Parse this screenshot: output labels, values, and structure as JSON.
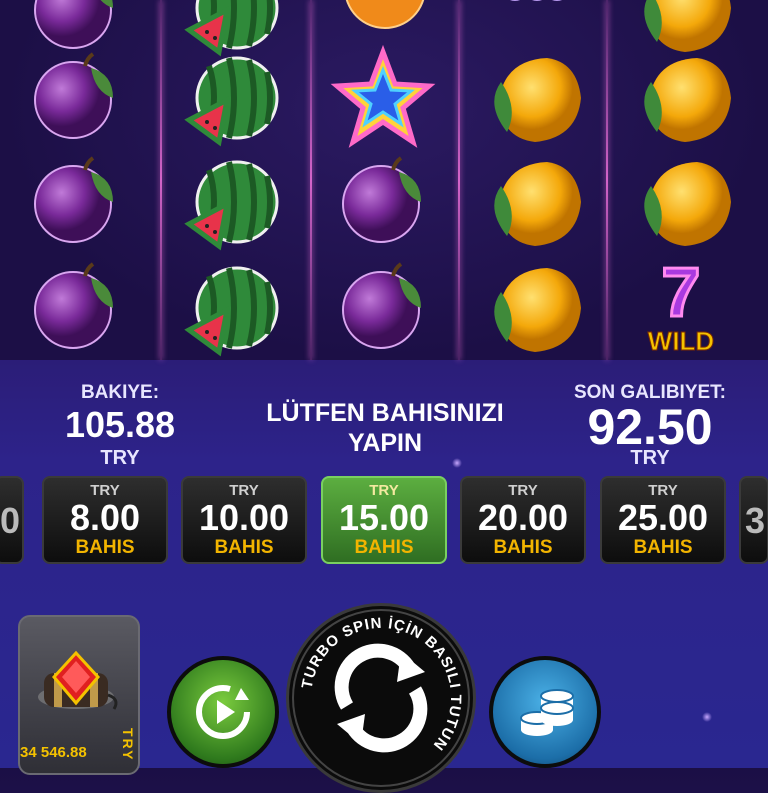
{
  "reels": [
    {
      "symbols": [
        "plum",
        "plum",
        "plum",
        "plum"
      ]
    },
    {
      "symbols": [
        "watermelon",
        "watermelon",
        "watermelon",
        "watermelon"
      ]
    },
    {
      "symbols": [
        "orange",
        "star",
        "plum",
        "plum"
      ]
    },
    {
      "symbols": [
        "grapes",
        "lemon",
        "lemon",
        "lemon"
      ]
    },
    {
      "symbols": [
        "lemon",
        "lemon",
        "lemon",
        "wild"
      ]
    }
  ],
  "wild_label": "WILD",
  "wild_number": "7",
  "balance": {
    "label": "BAKIYE:",
    "value": "105.88",
    "currency": "TRY"
  },
  "prompt": {
    "line1": "LÜTFEN BAHISINIZI",
    "line2": "YAPIN"
  },
  "last_win": {
    "label": "SON GALIBIYET:",
    "value": "92.50",
    "currency": "TRY"
  },
  "bets": [
    {
      "currency": "TRY",
      "amount": "8.00",
      "label": "BAHIS",
      "selected": false
    },
    {
      "currency": "TRY",
      "amount": "10.00",
      "label": "BAHIS",
      "selected": false
    },
    {
      "currency": "TRY",
      "amount": "15.00",
      "label": "BAHIS",
      "selected": true
    },
    {
      "currency": "TRY",
      "amount": "20.00",
      "label": "BAHIS",
      "selected": false
    },
    {
      "currency": "TRY",
      "amount": "25.00",
      "label": "BAHIS",
      "selected": false
    }
  ],
  "bet_edge_left": "0",
  "bet_edge_right": "3",
  "bonus": {
    "value": "34 546.88",
    "currency": "TRY"
  },
  "spin_ring_text": "TURBO SPIN İÇİN BASILI TUTUN",
  "icons": {
    "autoplay": "autoplay-icon",
    "spin": "spin-arrows-icon",
    "stake": "coin-stack-icon",
    "bonus": "dynamite-gem-icon"
  },
  "colors": {
    "accent_gold": "#f2b400",
    "selected_bet": "#4e9a36",
    "reel_separator": "#ff78e6"
  }
}
